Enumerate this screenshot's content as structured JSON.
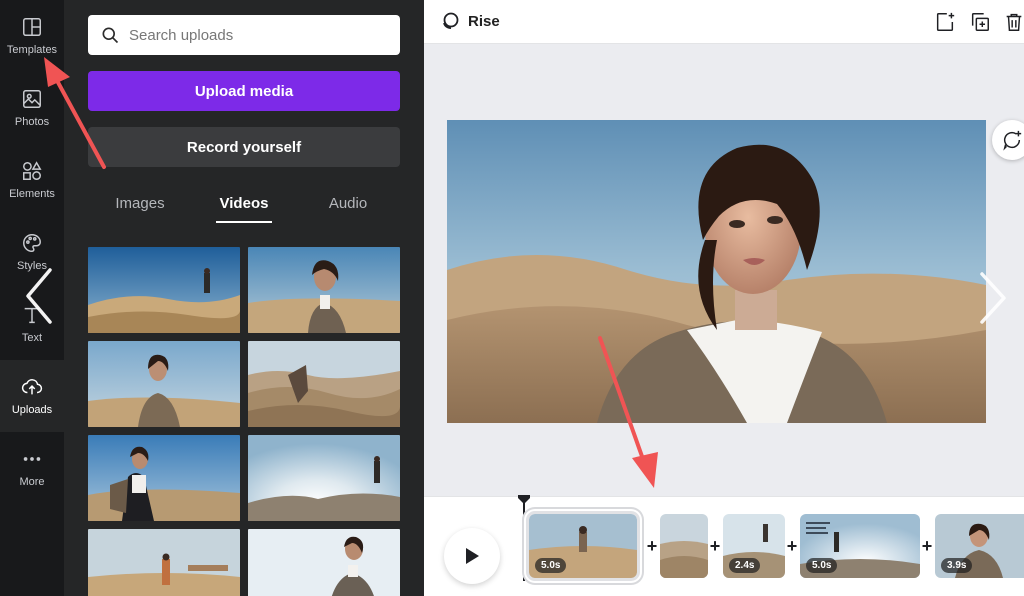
{
  "rail": {
    "items": [
      {
        "label": "Templates",
        "icon": "templates-icon"
      },
      {
        "label": "Photos",
        "icon": "photos-icon"
      },
      {
        "label": "Elements",
        "icon": "elements-icon"
      },
      {
        "label": "Styles",
        "icon": "styles-icon"
      },
      {
        "label": "Text",
        "icon": "text-icon"
      },
      {
        "label": "Uploads",
        "icon": "uploads-icon"
      },
      {
        "label": "More",
        "icon": "more-icon"
      }
    ]
  },
  "panel": {
    "search_placeholder": "Search uploads",
    "upload_label": "Upload media",
    "record_label": "Record yourself",
    "tabs": [
      {
        "label": "Images"
      },
      {
        "label": "Videos",
        "active": true
      },
      {
        "label": "Audio"
      }
    ]
  },
  "editor": {
    "animation_label": "Rise"
  },
  "timeline": {
    "clips": [
      {
        "duration": "5.0s"
      },
      {
        "duration": ""
      },
      {
        "duration": "2.4s"
      },
      {
        "duration": "5.0s"
      },
      {
        "duration": "3.9s"
      }
    ],
    "add_symbol": "+"
  },
  "colors": {
    "accent": "#7d2ae8",
    "rail_bg": "#18191b",
    "panel_bg": "#252627",
    "annotation_arrow": "#f05454"
  }
}
